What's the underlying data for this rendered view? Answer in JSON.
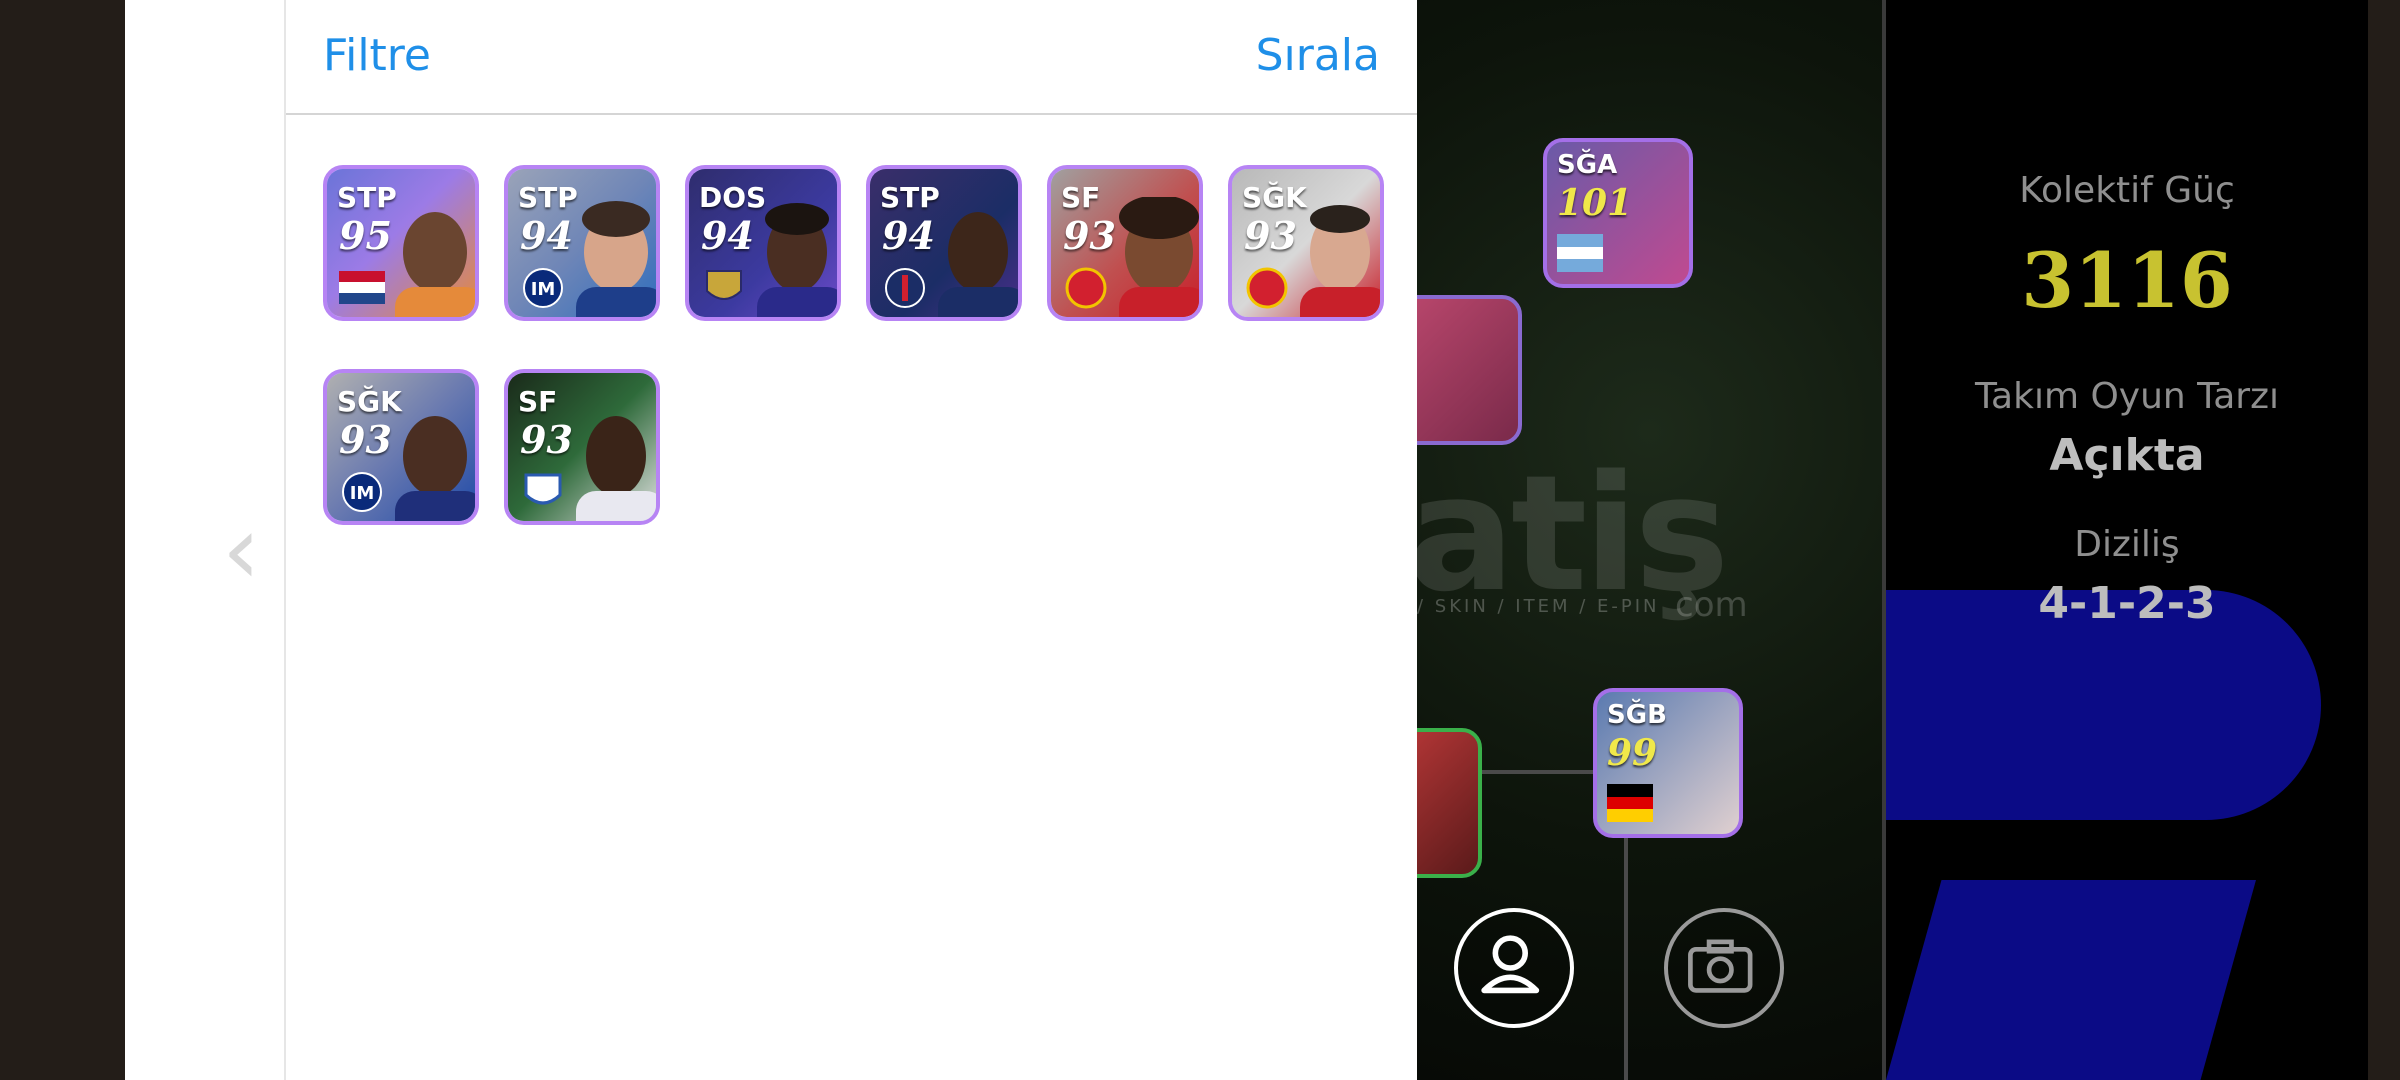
{
  "sheet": {
    "filter_label": "Filtre",
    "sort_label": "Sırala"
  },
  "players": [
    {
      "position": "STP",
      "rating": "95",
      "badge": "netherlands-flag",
      "theme": "#e58a3a"
    },
    {
      "position": "STP",
      "rating": "94",
      "badge": "inter-crest",
      "theme": "#2f6dbd"
    },
    {
      "position": "DOS",
      "rating": "94",
      "badge": "club-crest",
      "theme": "#3c3aa0"
    },
    {
      "position": "STP",
      "rating": "94",
      "badge": "psg-crest",
      "theme": "#1b2d66"
    },
    {
      "position": "SF",
      "rating": "93",
      "badge": "manchester-united-crest",
      "theme": "#c8202a"
    },
    {
      "position": "SĞK",
      "rating": "93",
      "badge": "manchester-united-crest",
      "theme": "#c8202a"
    },
    {
      "position": "SĞK",
      "rating": "93",
      "badge": "inter-crest",
      "theme": "#1f4aa8"
    },
    {
      "position": "SF",
      "rating": "93",
      "badge": "club-crest",
      "theme": "#2e6a3a"
    }
  ],
  "field": {
    "cards": [
      {
        "position": "SĞA",
        "rating": "101",
        "badge": "argentina-flag"
      },
      {
        "position": "SĞB",
        "rating": "99",
        "badge": "germany-flag"
      }
    ],
    "watermark": "atiş",
    "watermark_sub": "/ SKIN / ITEM / E-PIN",
    "watermark_domain": "com"
  },
  "team": {
    "strength_label": "Kolektif Güç",
    "strength_value": "3116",
    "playstyle_label": "Takım Oyun Tarzı",
    "playstyle_value": "Açıkta",
    "formation_label": "Diziliş",
    "formation_value": "4-1-2-3"
  }
}
